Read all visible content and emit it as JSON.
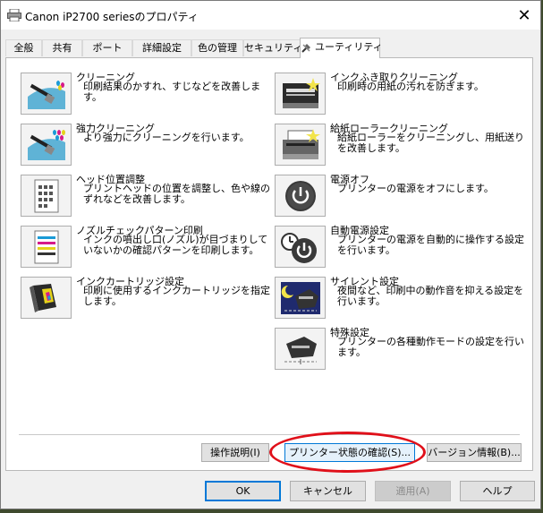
{
  "window": {
    "title": "Canon iP2700 seriesのプロパティ",
    "close_symbol": "✕"
  },
  "tabs": [
    {
      "label": "全般"
    },
    {
      "label": "共有"
    },
    {
      "label": "ポート"
    },
    {
      "label": "詳細設定"
    },
    {
      "label": "色の管理"
    },
    {
      "label": "セキュリティ"
    },
    {
      "label": "ユーティリティ",
      "active": true
    }
  ],
  "utilities_left": [
    {
      "name": "クリーニング",
      "desc": "印刷結果のかすれ、すじなどを改善します。",
      "icon": "cleaning-brush-icon"
    },
    {
      "name": "強力クリーニング",
      "desc": "より強力にクリーニングを行います。",
      "icon": "deep-cleaning-brush-icon"
    },
    {
      "name": "ヘッド位置調整",
      "desc": "プリントヘッドの位置を調整し、色や線のずれなどを改善します。",
      "icon": "print-head-alignment-icon"
    },
    {
      "name": "ノズルチェックパターン印刷",
      "desc": "インクの噴出し口(ノズル)が目づまりしていないかの確認パターンを印刷します。",
      "icon": "nozzle-check-pattern-icon"
    },
    {
      "name": "インクカートリッジ設定",
      "desc": "印刷に使用するインクカートリッジを指定します。",
      "icon": "ink-cartridge-icon"
    }
  ],
  "utilities_right": [
    {
      "name": "インクふき取りクリーニング",
      "desc": "印刷時の用紙の汚れを防ぎます。",
      "icon": "bottom-plate-cleaning-icon"
    },
    {
      "name": "給紙ローラークリーニング",
      "desc": "給紙ローラーをクリーニングし、用紙送りを改善します。",
      "icon": "roller-cleaning-icon"
    },
    {
      "name": "電源オフ",
      "desc": "プリンターの電源をオフにします。",
      "icon": "power-off-icon"
    },
    {
      "name": "自動電源設定",
      "desc": "プリンターの電源を自動的に操作する設定を行います。",
      "icon": "auto-power-icon"
    },
    {
      "name": "サイレント設定",
      "desc": "夜間など、印刷中の動作音を抑える設定を行います。",
      "icon": "quiet-mode-icon"
    },
    {
      "name": "特殊設定",
      "desc": "プリンターの各種動作モードの設定を行います。",
      "icon": "custom-settings-icon"
    }
  ],
  "bottom_buttons": {
    "manual": "操作説明(I)",
    "status": "プリンター状態の確認(S)...",
    "version": "バージョン情報(B)..."
  },
  "dialog_buttons": {
    "ok": "OK",
    "cancel": "キャンセル",
    "apply": "適用(A)",
    "help": "ヘルプ"
  },
  "colors": {
    "highlight": "#e0101a",
    "focus": "#0078d7"
  }
}
